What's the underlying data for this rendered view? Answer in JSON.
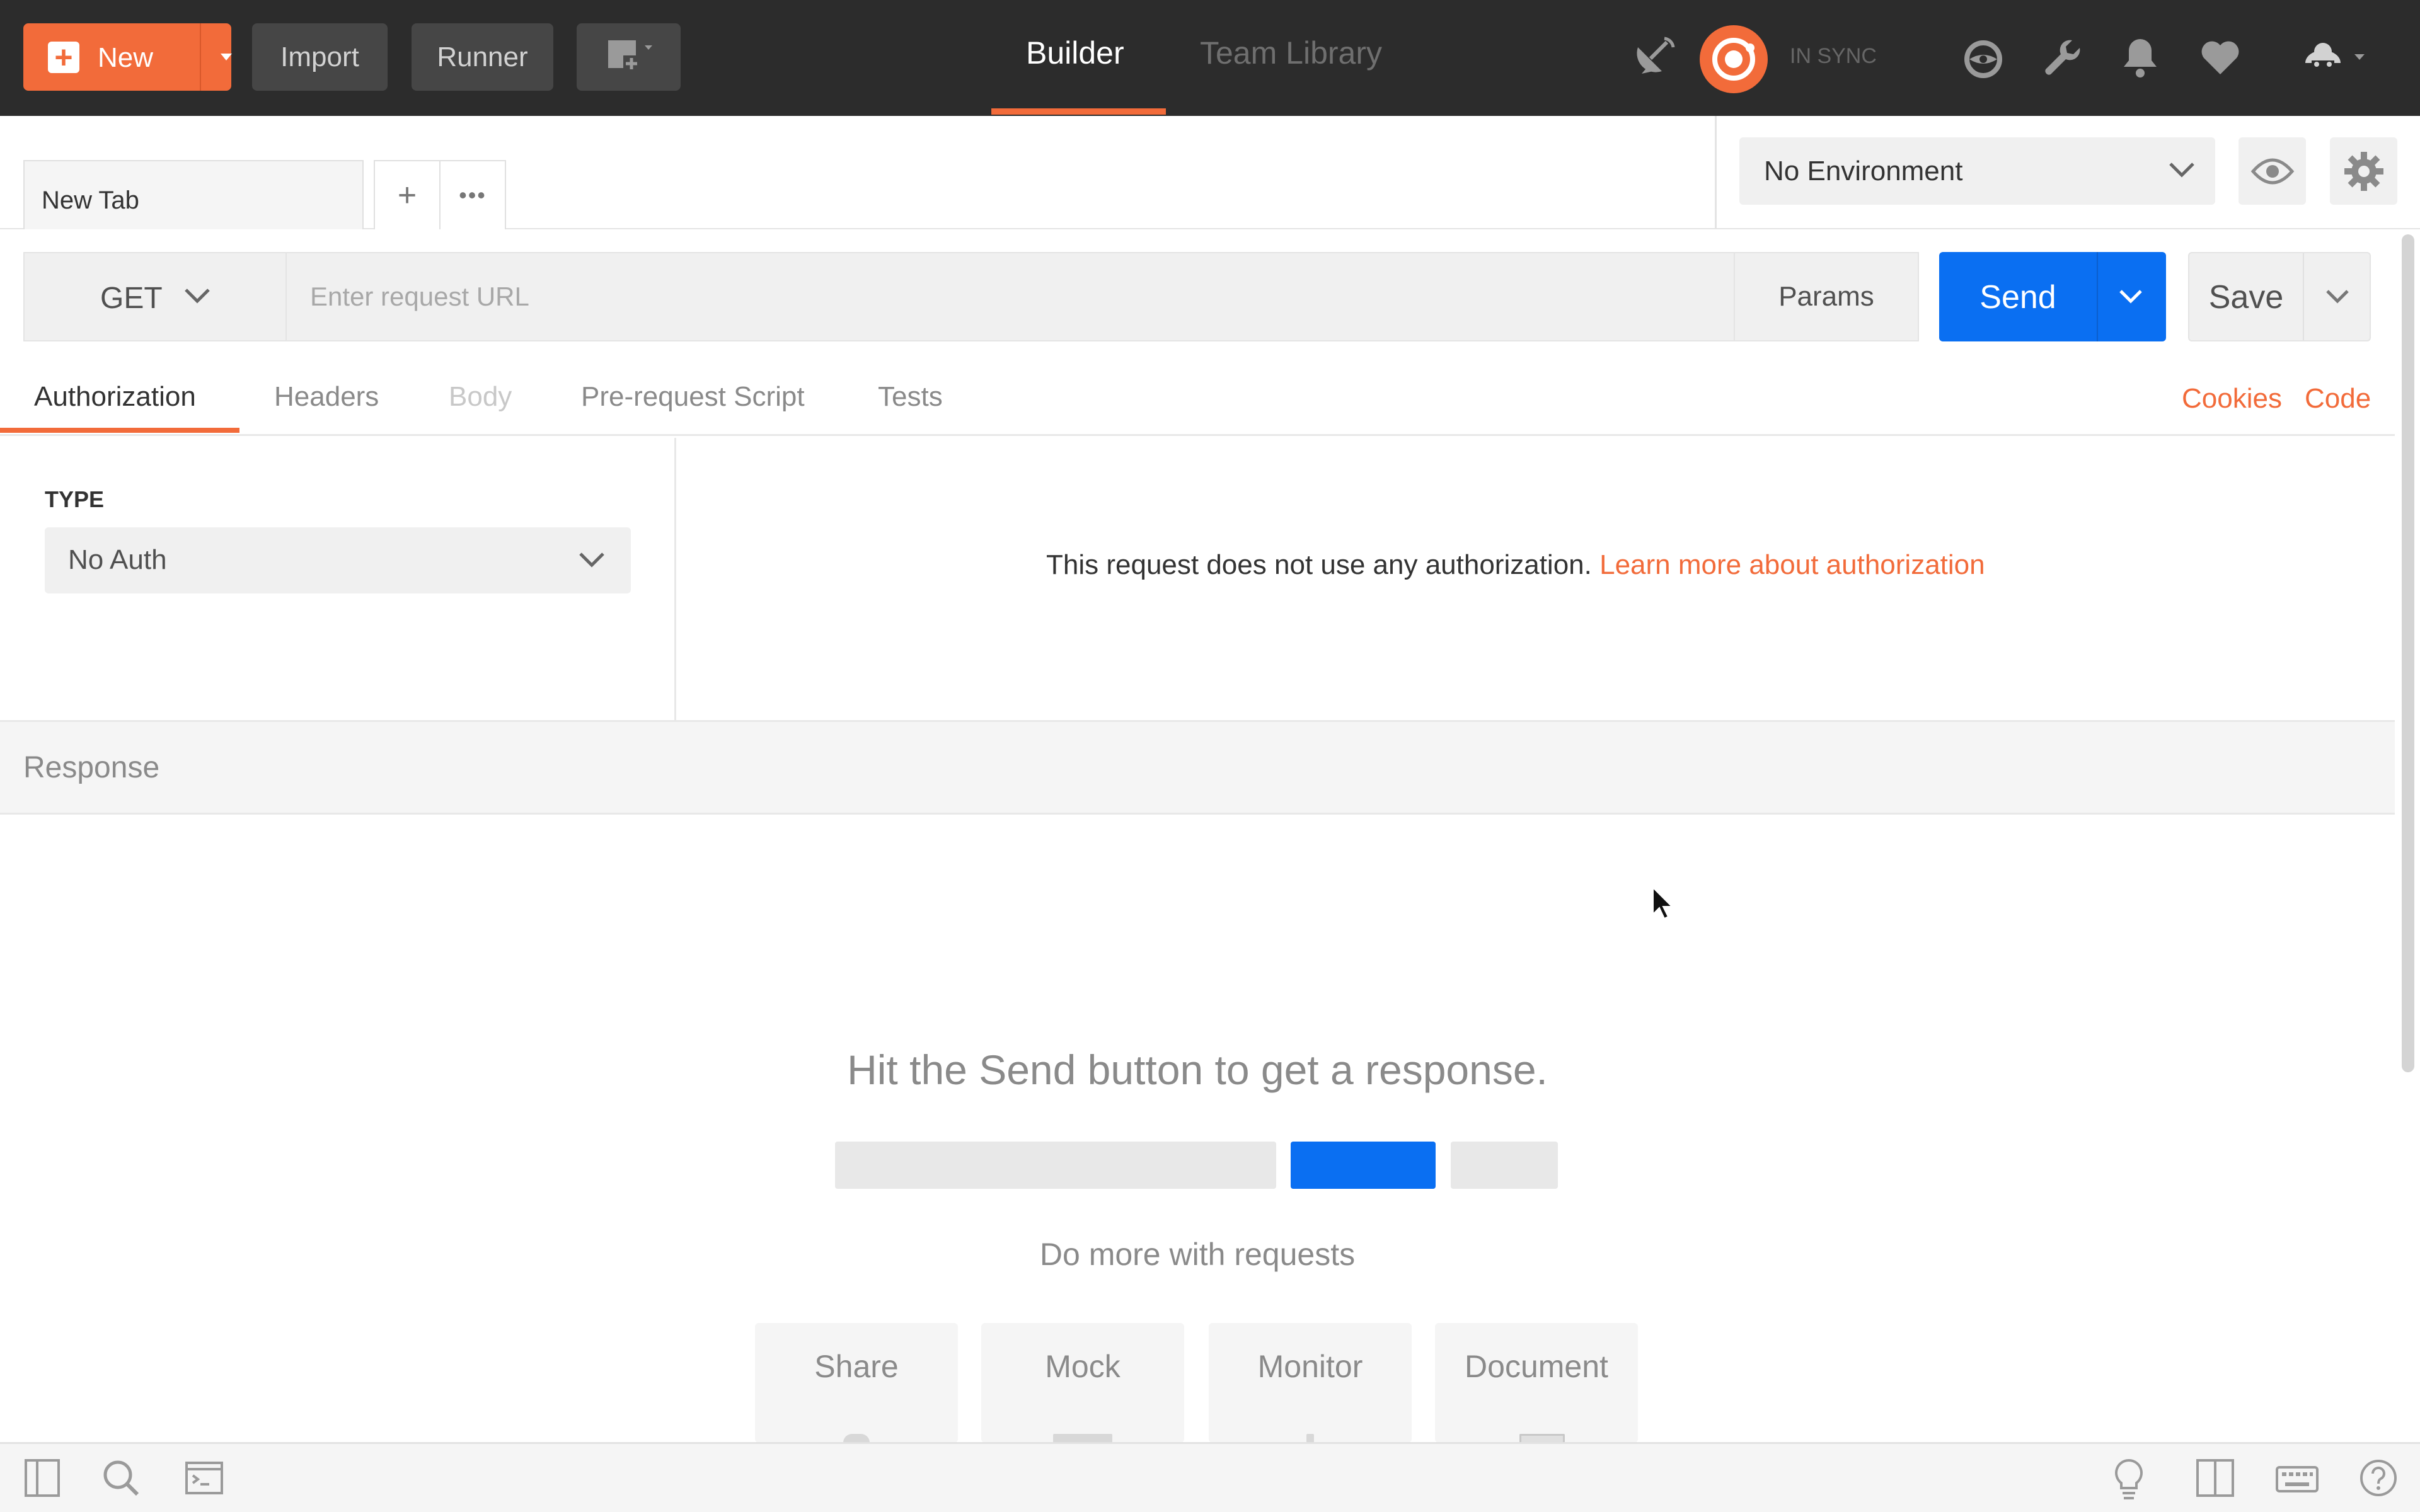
{
  "header": {
    "new_label": "New",
    "import_label": "Import",
    "runner_label": "Runner",
    "nav_tabs": [
      {
        "label": "Builder",
        "active": true
      },
      {
        "label": "Team Library",
        "active": false
      }
    ],
    "sync_status": "IN SYNC"
  },
  "tabs": {
    "active_tab_label": "New Tab",
    "add_tab_symbol": "+",
    "more_symbol": "•••"
  },
  "environment": {
    "selected": "No Environment"
  },
  "request": {
    "method": "GET",
    "url_placeholder": "Enter request URL",
    "params_label": "Params",
    "send_label": "Send",
    "save_label": "Save"
  },
  "subtabs": {
    "items": [
      {
        "label": "Authorization",
        "state": "active"
      },
      {
        "label": "Headers",
        "state": "normal"
      },
      {
        "label": "Body",
        "state": "disabled"
      },
      {
        "label": "Pre-request Script",
        "state": "normal"
      },
      {
        "label": "Tests",
        "state": "normal"
      }
    ],
    "cookies_label": "Cookies",
    "code_label": "Code"
  },
  "auth": {
    "type_label": "TYPE",
    "selected_type": "No Auth",
    "message": "This request does not use any authorization.",
    "learn_more": "Learn more about authorization"
  },
  "response": {
    "title": "Response",
    "hint": "Hit the Send button to get a response.",
    "do_more": "Do more with requests",
    "cards": [
      "Share",
      "Mock",
      "Monitor",
      "Document"
    ]
  },
  "colors": {
    "accent_orange": "#f26b3a",
    "send_blue": "#0a6ff2",
    "header_bg": "#2c2c2c"
  }
}
